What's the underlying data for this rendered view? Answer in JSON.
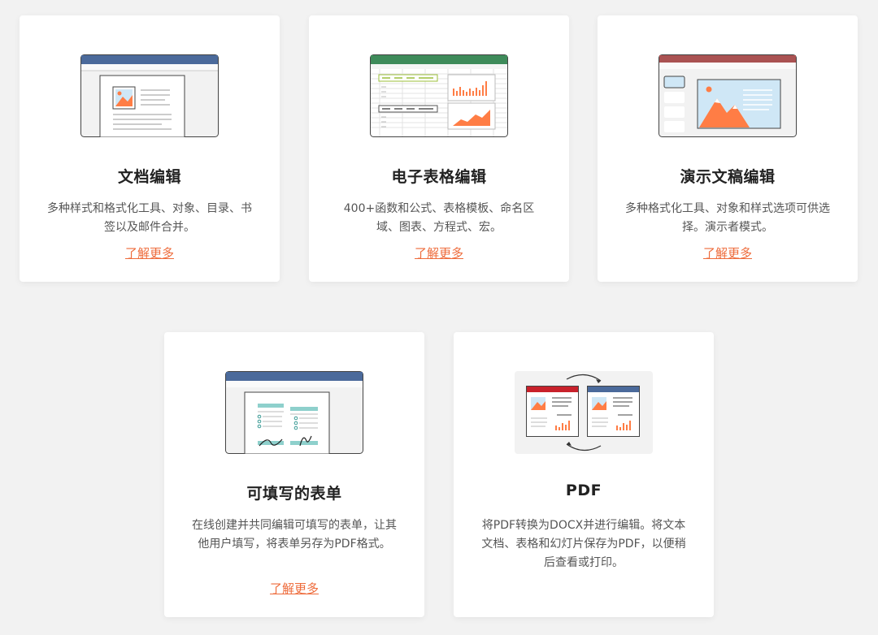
{
  "cards": [
    {
      "title": "文档编辑",
      "desc": "多种样式和格式化工具、对象、目录、书签以及邮件合并。",
      "link": "了解更多",
      "icon": "document-editor-icon",
      "accent": "#4b6a9b"
    },
    {
      "title": "电子表格编辑",
      "desc": "400+函数和公式、表格模板、命名区域、图表、方程式、宏。",
      "link": "了解更多",
      "icon": "spreadsheet-editor-icon",
      "accent": "#3e8b5a"
    },
    {
      "title": "演示文稿编辑",
      "desc": "多种格式化工具、对象和样式选项可供选择。演示者模式。",
      "link": "了解更多",
      "icon": "presentation-editor-icon",
      "accent": "#aa5252"
    },
    {
      "title": "可填写的表单",
      "desc": "在线创建并共同编辑可填写的表单，让其他用户填写，将表单另存为PDF格式。",
      "link": "了解更多",
      "icon": "fillable-form-icon",
      "accent": "#4b6a9b"
    },
    {
      "title": "PDF",
      "desc": "将PDF转换为DOCX并进行编辑。将文本文档、表格和幻灯片保存为PDF，以便稍后查看或打印。",
      "link": "",
      "icon": "pdf-convert-icon",
      "accent": "#c8212b"
    }
  ],
  "colors": {
    "background": "#f2f2f2",
    "card": "#ffffff",
    "link": "#ee6b3b",
    "orange": "#ff7d45"
  }
}
